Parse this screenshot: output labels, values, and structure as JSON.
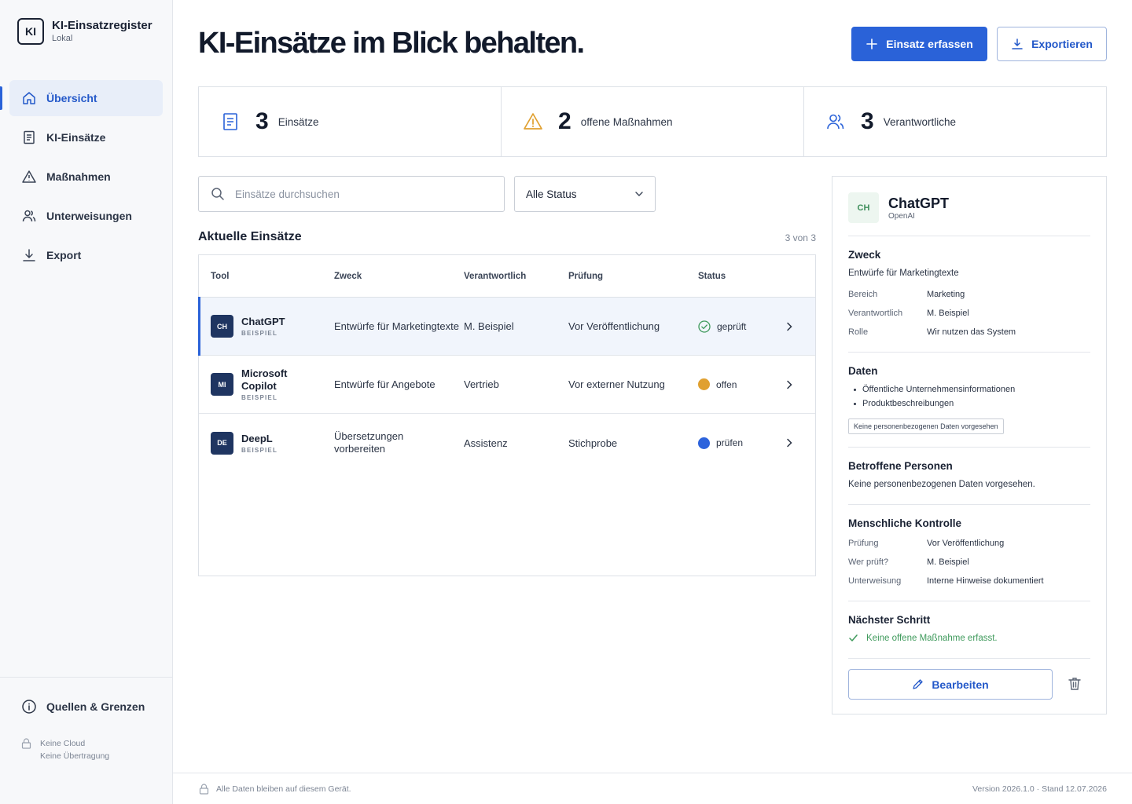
{
  "brand": {
    "logo": "KI",
    "title": "KI-Einsatzregister",
    "subtitle": "Lokal"
  },
  "nav": [
    {
      "label": "Übersicht",
      "icon": "home-icon",
      "active": true
    },
    {
      "label": "KI-Einsätze",
      "icon": "document-icon"
    },
    {
      "label": "Maßnahmen",
      "icon": "warning-icon"
    },
    {
      "label": "Unterweisungen",
      "icon": "users-icon"
    },
    {
      "label": "Export",
      "icon": "download-icon"
    }
  ],
  "sidebar_bottom": {
    "label": "Quellen & Grenzen",
    "note_line1": "Keine Cloud",
    "note_line2": "Keine Übertragung"
  },
  "header": {
    "title": "KI-Einsätze im Blick behalten.",
    "primary_button": "Einsatz erfassen",
    "export_button": "Exportieren"
  },
  "stats": [
    {
      "value": "3",
      "label": "Einsätze",
      "icon": "document-icon"
    },
    {
      "value": "2",
      "label": "offene Maßnahmen",
      "icon": "warning-icon"
    },
    {
      "value": "3",
      "label": "Verantwortliche",
      "icon": "users-icon"
    }
  ],
  "search": {
    "placeholder": "Einsätze durchsuchen"
  },
  "filter": {
    "selected": "Alle Status"
  },
  "list": {
    "title": "Aktuelle Einsätze",
    "count": "3 von 3"
  },
  "table": {
    "headers": [
      "Tool",
      "Zweck",
      "Verantwortlich",
      "Prüfung",
      "Status"
    ],
    "rows": [
      {
        "badge": "CH",
        "name": "ChatGPT",
        "tag": "BEISPIEL",
        "purpose": "Entwürfe für Marketingtexte",
        "owner": "M. Beispiel",
        "review": "Vor Veröffentlichung",
        "status": "geprüft",
        "selected": true
      },
      {
        "badge": "MI",
        "name": "Microsoft Copilot",
        "tag": "BEISPIEL",
        "purpose": "Entwürfe für Angebote",
        "owner": "Vertrieb",
        "review": "Vor externer Nutzung",
        "status": "offen"
      },
      {
        "badge": "DE",
        "name": "DeepL",
        "tag": "BEISPIEL",
        "purpose": "Übersetzungen vorbereiten",
        "owner": "Assistenz",
        "review": "Stichprobe",
        "status": "prüfen"
      }
    ]
  },
  "colors": {
    "accent": "#2a62d8",
    "status_checked": "#3f9a5c",
    "status_open": "#e0a030",
    "status_review": "#2d63dc",
    "badge_bg": "#1f3561"
  },
  "detail": {
    "badge": "CH",
    "name": "ChatGPT",
    "vendor": "OpenAI",
    "purpose_heading": "Zweck",
    "purpose": "Entwürfe für Marketingtexte",
    "purpose_fields": [
      {
        "key": "Bereich",
        "value": "Marketing"
      },
      {
        "key": "Verantwortlich",
        "value": "M. Beispiel"
      },
      {
        "key": "Rolle",
        "value": "Wir nutzen das System"
      }
    ],
    "data_heading": "Daten",
    "data_items": [
      "Öffentliche Unternehmensinformationen",
      "Produktbeschreibungen"
    ],
    "data_chip": "Keine personenbezogenen Daten vorgesehen",
    "persons_heading": "Betroffene Personen",
    "persons_text": "Keine personenbezogenen Daten vorgesehen.",
    "control_heading": "Menschliche Kontrolle",
    "control_fields": [
      {
        "key": "Prüfung",
        "value": "Vor Veröffentlichung"
      },
      {
        "key": "Wer prüft?",
        "value": "M. Beispiel"
      },
      {
        "key": "Unterweisung",
        "value": "Interne Hinweise dokumentiert"
      }
    ],
    "next_heading": "Nächster Schritt",
    "next_text": "Keine offene Maßnahme erfasst.",
    "edit_button": "Bearbeiten"
  },
  "footer": {
    "left": "Alle Daten bleiben auf diesem Gerät.",
    "right": "Version 2026.1.0 · Stand 12.07.2026"
  }
}
